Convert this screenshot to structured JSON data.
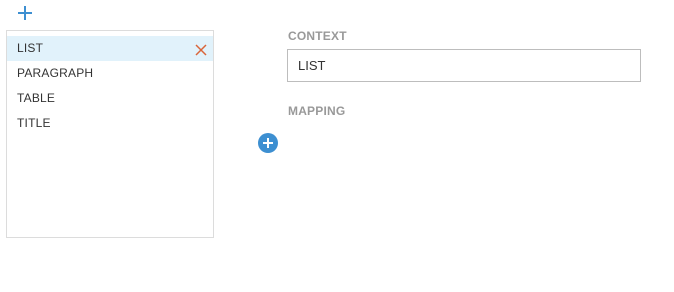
{
  "icons": {
    "top_add": "plus-icon",
    "remove": "close-icon",
    "add_mapping": "plus-circle-icon"
  },
  "colors": {
    "accent": "#3d8fd1",
    "selected_bg": "#e1f2fb",
    "remove": "#d9653a",
    "label": "#999999"
  },
  "list": {
    "items": [
      {
        "label": "LIST",
        "selected": true
      },
      {
        "label": "PARAGRAPH",
        "selected": false
      },
      {
        "label": "TABLE",
        "selected": false
      },
      {
        "label": "TITLE",
        "selected": false
      }
    ]
  },
  "form": {
    "context_label": "CONTEXT",
    "context_value": "LIST",
    "mapping_label": "MAPPING"
  }
}
